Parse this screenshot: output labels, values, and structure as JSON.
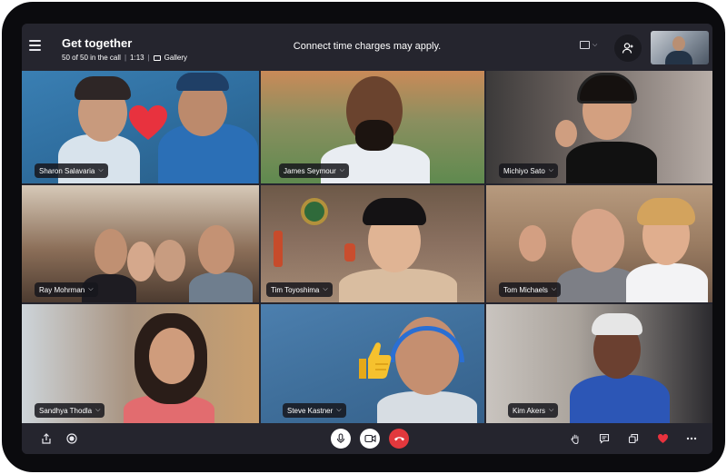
{
  "header": {
    "title": "Get together",
    "participants": "50 of 50 in the call",
    "duration": "1:13",
    "view_mode": "Gallery",
    "notice": "Connect time charges may apply."
  },
  "participants": [
    {
      "name": "Sharon Salavaria"
    },
    {
      "name": "James Seymour"
    },
    {
      "name": "Michiyo Sato"
    },
    {
      "name": "Ray Mohrman"
    },
    {
      "name": "Tim Toyoshima"
    },
    {
      "name": "Tom Michaels"
    },
    {
      "name": "Sandhya Thodla"
    },
    {
      "name": "Steve Kastner"
    },
    {
      "name": "Kim Akers"
    }
  ],
  "icons": {
    "menu": "hamburger-menu-icon",
    "layout": "layout-frame-icon",
    "add_people": "add-person-icon",
    "share": "share-icon",
    "record": "record-icon",
    "mic": "microphone-icon",
    "video": "video-camera-icon",
    "hangup": "end-call-icon",
    "raise_hand": "raise-hand-icon",
    "chat": "chat-icon",
    "switch": "switch-window-icon",
    "react": "heart-icon",
    "more": "more-options-icon"
  },
  "colors": {
    "hangup": "#e2383d",
    "heart": "#e8323e",
    "toolbar_bg": "#25252e"
  }
}
